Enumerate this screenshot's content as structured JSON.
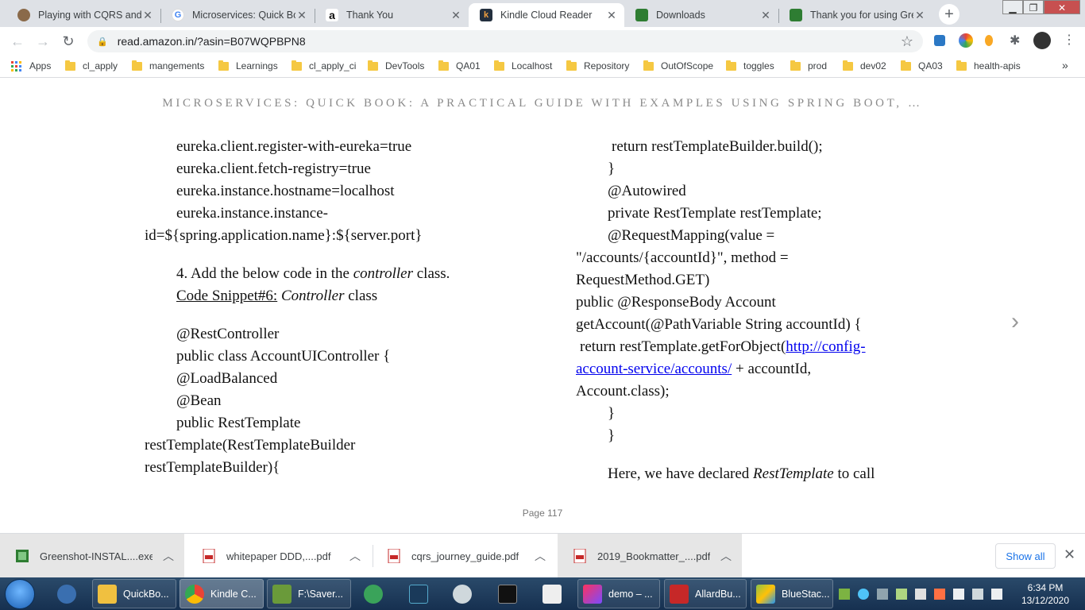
{
  "tabs": [
    {
      "title": "Playing with CQRS and E"
    },
    {
      "title": "Microservices: Quick Boo"
    },
    {
      "title": "Thank You"
    },
    {
      "title": "Kindle Cloud Reader"
    },
    {
      "title": "Downloads"
    },
    {
      "title": "Thank you for using Gre"
    }
  ],
  "address": {
    "url": "read.amazon.in/?asin=B07WQPBPN8"
  },
  "bookmarks": {
    "apps": "Apps",
    "items": [
      "cl_apply",
      "mangements",
      "Learnings",
      "cl_apply_ci",
      "DevTools",
      "QA01",
      "Localhost",
      "Repository",
      "OutOfScope",
      "toggles",
      "prod",
      "dev02",
      "QA03",
      "health-apis"
    ],
    "more": "»"
  },
  "reader": {
    "book_title": "MICROSERVICES: QUICK BOOK: A PRACTICAL GUIDE WITH EXAMPLES USING SPRING BOOT, …",
    "left": {
      "l1": "eureka.client.register-with-eureka=true",
      "l2": "eureka.client.fetch-registry=true",
      "l3": "eureka.instance.hostname=localhost",
      "l4": "eureka.instance.instance-",
      "l5": "id=${spring.application.name}:${server.port}",
      "step_prefix": "4. Add the below code in the ",
      "step_em": "controller",
      "step_suffix": " class.",
      "snippet_link": "Code Snippet#6:",
      "snippet_em": "Controller",
      "snippet_suffix": " class",
      "c1": "@RestController",
      "c2": "public class AccountUIController {",
      "c3": "@LoadBalanced",
      "c4": "@Bean",
      "c5": "public RestTemplate",
      "c6": "restTemplate(RestTemplateBuilder",
      "c7": "restTemplateBuilder){"
    },
    "right": {
      "r1": "return restTemplateBuilder.build();",
      "r2": "}",
      "r3": "@Autowired",
      "r4": "private RestTemplate restTemplate;",
      "r5": "@RequestMapping(value =",
      "r6": "\"/accounts/{accountId}\", method =",
      "r7": "RequestMethod.GET)",
      "r8": "public @ResponseBody Account",
      "r9": "getAccount(@PathVariable String accountId) {",
      "r10_prefix": "return  restTemplate.getForObject(",
      "r10_link1": "http://config-",
      "r11_link": "account-service/accounts/",
      "r11_suffix": " + accountId,",
      "r12": "Account.class);",
      "r13": "}",
      "r14": "}",
      "p_prefix": "Here, we have declared ",
      "p_em": "RestTemplate",
      "p_suffix": " to call"
    },
    "page": "Page 117"
  },
  "downloads": {
    "items": [
      "Greenshot-INSTAL....exe",
      "whitepaper DDD,....pdf",
      "cqrs_journey_guide.pdf",
      "2019_Bookmatter_....pdf"
    ],
    "show_all": "Show all"
  },
  "taskbar": {
    "tasks": [
      "QuickBo...",
      "Kindle C...",
      "F:\\Saver...",
      "demo – ...",
      "AllardBu...",
      "BlueStac..."
    ],
    "time": "6:34 PM",
    "date": "13/12/2020"
  },
  "colors": {
    "link": "#0000ee",
    "accent": "#1a73e8",
    "tab_bar": "#dee1e6",
    "taskbar": "#1e3a5c"
  }
}
